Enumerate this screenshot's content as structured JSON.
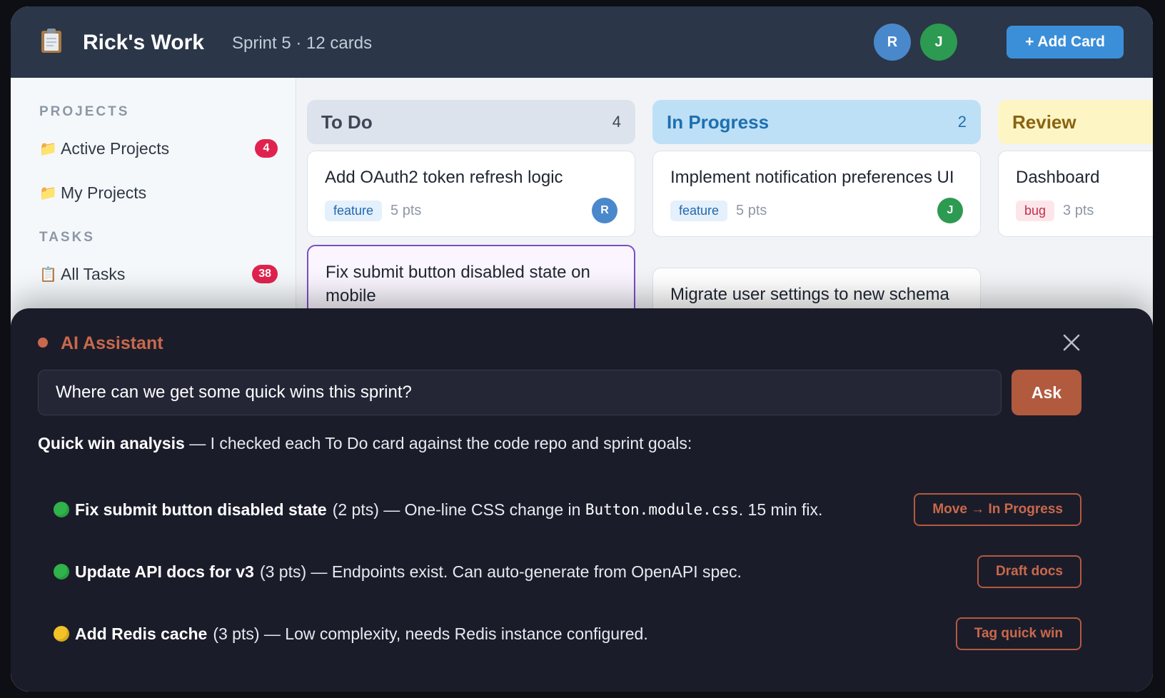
{
  "header": {
    "title": "Rick's Work",
    "sprint_info": "Sprint 5 · 12 cards",
    "avatars": [
      {
        "initial": "R",
        "color": "#4a88cc"
      },
      {
        "initial": "J",
        "color": "#2c9a50"
      }
    ],
    "add_card_label": "+ Add Card"
  },
  "sidebar": {
    "projects_heading": "PROJECTS",
    "tasks_heading": "TASKS",
    "items": [
      {
        "label": "Active Projects",
        "icon": "folder-icon",
        "badge": "4"
      },
      {
        "label": "My Projects",
        "icon": "folder-icon",
        "badge": ""
      },
      {
        "label": "All Tasks",
        "icon": "clipboard-icon",
        "badge": "38"
      }
    ]
  },
  "board": {
    "columns": [
      {
        "title": "To Do",
        "count": "4",
        "bg": "#dde3ec",
        "fg": "#3d4756",
        "cards": [
          {
            "title": "Add OAuth2 token refresh logic",
            "tag": "feature",
            "points": "5 pts",
            "assignee": "R"
          },
          {
            "title": "Fix submit button disabled state on mobile"
          }
        ]
      },
      {
        "title": "In Progress",
        "count": "2",
        "bg": "#bde0f6",
        "fg": "#1f6fb0",
        "cards": [
          {
            "title": "Implement notification preferences UI",
            "tag": "feature",
            "points": "5 pts",
            "assignee": "J"
          },
          {
            "title": "Migrate user settings to new schema"
          }
        ]
      },
      {
        "title": "Review",
        "count": "",
        "bg": "#fdf6c4",
        "fg": "#8a6312",
        "cards": [
          {
            "title": "Dashboard",
            "tag": "bug",
            "points": "3 pts"
          }
        ]
      }
    ]
  },
  "ai": {
    "title": "AI Assistant",
    "input_value": "Where can we get some quick wins this sprint?",
    "ask_label": "Ask",
    "summary_bold": "Quick win analysis",
    "summary_rest": " — I checked each To Do card against the code repo and sprint goals:",
    "recommendations": [
      {
        "status": "green",
        "color": "#2fb34a",
        "name": "Fix submit button disabled state",
        "detail_a": "(2 pts) — One-line CSS change in ",
        "code": "Button.module.css",
        "detail_b": ". 15 min fix.",
        "action": "Move → In Progress"
      },
      {
        "status": "green",
        "color": "#2fb34a",
        "name": "Update API docs for v3",
        "detail_a": "(3 pts) — Endpoints exist. Can auto-generate from OpenAPI spec.",
        "code": "",
        "detail_b": "",
        "action": "Draft docs"
      },
      {
        "status": "yellow",
        "color": "#f3c226",
        "name": "Add Redis cache",
        "detail_a": "(3 pts) — Low complexity, needs Redis instance configured.",
        "code": "",
        "detail_b": "",
        "action": "Tag quick win"
      }
    ]
  }
}
